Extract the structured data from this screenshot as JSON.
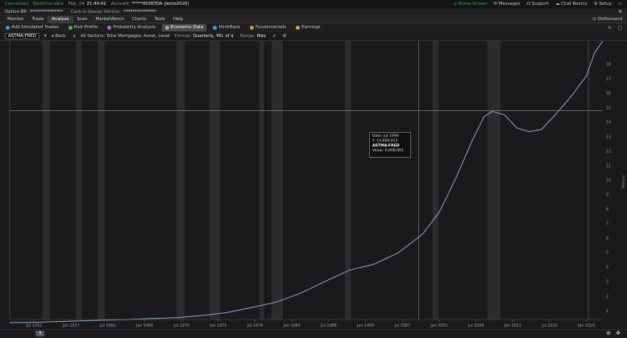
{
  "status": {
    "connected": "Connected",
    "realtime": "Realtime data",
    "date": "Feb, 24",
    "time": "21:40:41",
    "account_label": "Account:",
    "account_value": "*****0036TDA (jemo2020)",
    "right": [
      "Home Screen",
      "Messages",
      "Support",
      "Chat Rooms",
      "Setup"
    ]
  },
  "bp": {
    "option_bp": "Option BP:",
    "option_val": "***************",
    "cash_label": "Cash & Sweep Vehicle:",
    "cash_val": "***************"
  },
  "tabs": [
    "Monitor",
    "Trade",
    "Analyze",
    "Scan",
    "MarketWatch",
    "Charts",
    "Tools",
    "Help"
  ],
  "tabs_active": 2,
  "ondemand": "OnDemand",
  "subtabs": [
    "Add Simulated Trades",
    "Risk Profile",
    "Probability Analysis",
    "Economic Data",
    "thinkBack",
    "Fundamentals",
    "Earnings"
  ],
  "subtabs_active": 3,
  "toolbar": {
    "symbol": "ASTMA:FRED",
    "back": "Back",
    "series_desc": "All Sectors; Total Mortgages; Asset, Level",
    "format_label": "Format:",
    "format_value": "Quarterly, Mil. of $",
    "range_label": "Range:",
    "range_value": "Max"
  },
  "tooltip": {
    "date_label": "Date:",
    "date_value": "Jul 1999",
    "y_label": "Y:",
    "y_value": "14,809,912",
    "series": "ASTMA:FRED",
    "value_label": "Value:",
    "value_value": "6,068,601"
  },
  "chart_data": {
    "type": "line",
    "x_ticks": [
      "Jul 1952",
      "Jan 1957",
      "Jul 1961",
      "Jan 1966",
      "Jul 1970",
      "Jan 1975",
      "Jul 1979",
      "Jan 1984",
      "Jul 1988",
      "Jan 1993",
      "Jul 1997",
      "Jan 2002",
      "Jul 2006",
      "Jan 2011",
      "Jul 2015",
      "Jan 2020"
    ],
    "y_ticks": [
      "1",
      "2",
      "3",
      "4",
      "5",
      "6",
      "7",
      "8",
      "9",
      "10",
      "11",
      "12",
      "13",
      "14",
      "15",
      "16",
      "17",
      "18"
    ],
    "y_axis_label": "Millions",
    "y_range": [
      0.4,
      19.6
    ],
    "x_range": [
      1949.5,
      2022.0
    ],
    "crosshair": {
      "x": 1999.5,
      "y": 14.81
    },
    "recessions": [
      [
        1953.5,
        1954.4
      ],
      [
        1957.6,
        1958.3
      ],
      [
        1960.3,
        1961.1
      ],
      [
        1969.9,
        1970.9
      ],
      [
        1973.9,
        1975.2
      ],
      [
        1980.0,
        1980.6
      ],
      [
        1981.5,
        1982.9
      ],
      [
        1990.5,
        1991.2
      ],
      [
        2001.2,
        2001.9
      ],
      [
        2007.9,
        2009.5
      ],
      [
        2020.1,
        2020.4
      ]
    ],
    "x": [
      1949.5,
      1952,
      1955,
      1958,
      1961,
      1964,
      1967,
      1970,
      1973,
      1976,
      1979,
      1982,
      1985,
      1988,
      1991,
      1994,
      1997,
      2000,
      2002,
      2004,
      2006,
      2007.5,
      2008.5,
      2010,
      2011.5,
      2013,
      2014.5,
      2016,
      2018,
      2020,
      2021,
      2022
    ],
    "y": [
      0.18,
      0.2,
      0.25,
      0.3,
      0.35,
      0.4,
      0.47,
      0.53,
      0.68,
      0.87,
      1.22,
      1.58,
      2.2,
      3.0,
      3.8,
      4.2,
      5.0,
      6.3,
      7.8,
      10.1,
      12.7,
      14.4,
      14.75,
      14.5,
      13.6,
      13.35,
      13.5,
      14.4,
      15.7,
      17.2,
      18.8,
      19.6
    ]
  }
}
